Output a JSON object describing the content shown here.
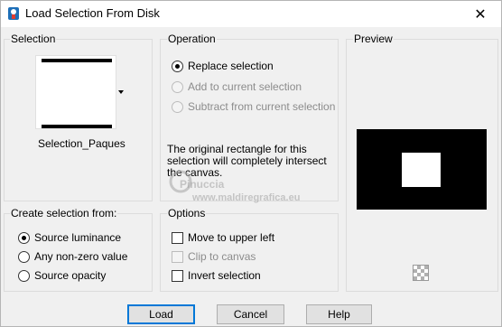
{
  "window": {
    "title": "Load Selection From Disk",
    "close_glyph": "✕"
  },
  "selection": {
    "label": "Selection",
    "file_name": "Selection_Paques"
  },
  "operation": {
    "label": "Operation",
    "options": [
      {
        "label": "Replace selection",
        "checked": true,
        "disabled": false
      },
      {
        "label": "Add to current selection",
        "checked": false,
        "disabled": true
      },
      {
        "label": "Subtract from current selection",
        "checked": false,
        "disabled": true
      }
    ],
    "note": "The original rectangle for this selection will completely intersect the canvas."
  },
  "preview": {
    "label": "Preview"
  },
  "create_from": {
    "label": "Create selection from:",
    "options": [
      {
        "label": "Source luminance",
        "checked": true
      },
      {
        "label": "Any non-zero value",
        "checked": false
      },
      {
        "label": "Source opacity",
        "checked": false
      }
    ]
  },
  "options": {
    "label": "Options",
    "items": [
      {
        "label": "Move to upper left",
        "checked": false,
        "disabled": false
      },
      {
        "label": "Clip to canvas",
        "checked": false,
        "disabled": true
      },
      {
        "label": "Invert selection",
        "checked": false,
        "disabled": false
      }
    ]
  },
  "watermark": {
    "line1": "Pinuccia",
    "line2": "www.maldiregrafica.eu"
  },
  "buttons": {
    "load": "Load",
    "cancel": "Cancel",
    "help": "Help"
  },
  "colors": {
    "accent": "#0078d7",
    "preview_bg": "#000000",
    "preview_rect": "#ffffff"
  }
}
